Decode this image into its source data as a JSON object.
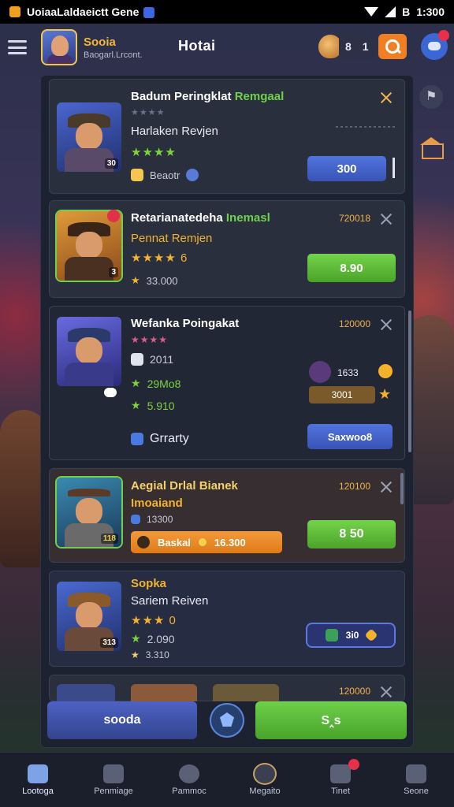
{
  "status_bar": {
    "title": "UoiaaLaldaeictt Gene",
    "time": "1:300",
    "battery_text": "B"
  },
  "header": {
    "profile_name": "Sooia",
    "profile_sub": "Baogarl.Lrcont.",
    "title": "Hotai",
    "currency_a": "8",
    "currency_b": "1"
  },
  "cards": [
    {
      "title": "Badum Peringklat",
      "title_accent": "Remgaal",
      "sub": "Harlaken Revjen",
      "stars": "★★★★",
      "stars_top": "★★★★",
      "meta": "Beaotr",
      "button": "300",
      "portrait_tag": "30"
    },
    {
      "title": "Retarianatedeha",
      "title_accent": "Inemasl",
      "sub": "Pennat Remjen",
      "stars": "★★★★",
      "stars_suffix": "6",
      "meta": "33.000",
      "count": "720018",
      "button": "8.90",
      "portrait_tag": "3"
    },
    {
      "title": "Wefanka Poingakat",
      "stat1": "2011",
      "stat2": "29Mo8",
      "stat3": "5.910",
      "stars": "★★★★",
      "count": "120000",
      "side_a": "1633",
      "side_b": "3001",
      "filter_label": "Grrarty",
      "button": "Saxwoo8"
    },
    {
      "title": "Aegial Drlal Bianek",
      "sub": "Imoaiand",
      "stat1": "13300",
      "badge_left": "Baskal",
      "badge_right": "16.300",
      "count": "120100",
      "button": "8 50",
      "portrait_tag": "118"
    },
    {
      "title": "Sopka",
      "sub": "Sariem Reiven",
      "stars": "★★★",
      "stars_suffix": "0",
      "stat1": "2.090",
      "stat2": "3.310",
      "tag": "3i0",
      "portrait_tag": "313"
    },
    {
      "count": "120000"
    }
  ],
  "actions": {
    "left": "sooda",
    "right": "S‸s"
  },
  "bottom_nav": [
    {
      "label": "Lootoga"
    },
    {
      "label": "Penmiage"
    },
    {
      "label": "Pammoc"
    },
    {
      "label": "Megaito"
    },
    {
      "label": "Tinet"
    },
    {
      "label": "Seone"
    }
  ],
  "colors": {
    "accent_gold": "#f3b63a",
    "accent_green": "#6fd14a",
    "accent_blue": "#3b66d6",
    "accent_orange": "#f07f23"
  },
  "icons": [
    "menu-icon",
    "search-icon",
    "chat-icon",
    "trophy-icon",
    "shop-icon",
    "close-icon",
    "star-icon",
    "home-icon",
    "store-icon",
    "network-icon",
    "compass-icon",
    "bell-icon",
    "team-icon"
  ]
}
